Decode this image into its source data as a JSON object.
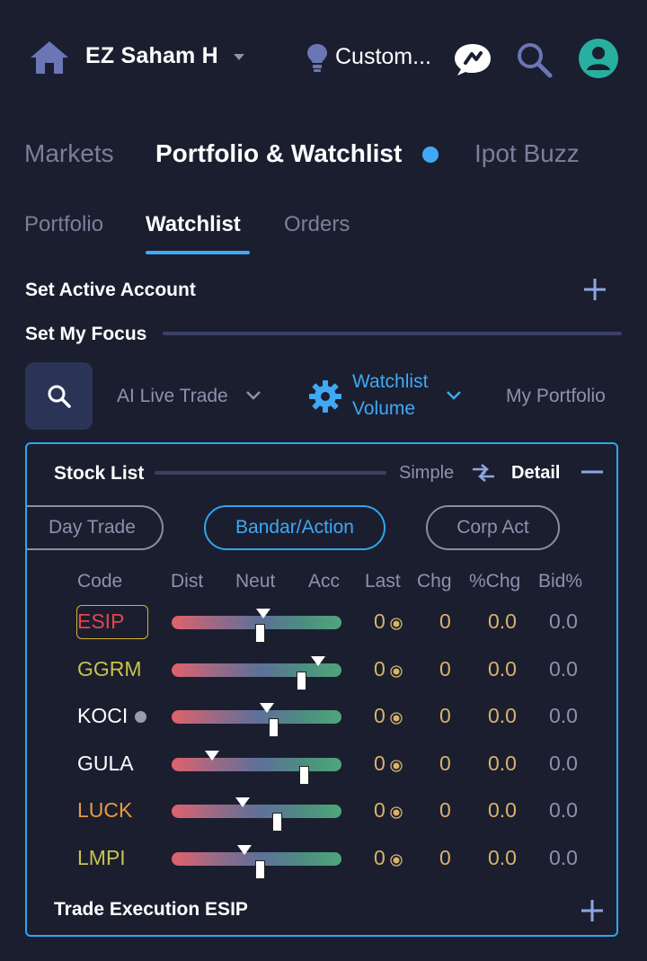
{
  "header": {
    "account_name": "EZ Saham H",
    "custom_label": "Custom...",
    "icons": [
      "home-icon",
      "caret-down-icon",
      "lightbulb-icon",
      "chat-icon",
      "search-icon",
      "user-icon"
    ]
  },
  "main_tabs": [
    {
      "label": "Markets",
      "active": false
    },
    {
      "label": "Portfolio & Watchlist",
      "active": true
    },
    {
      "label": "Ipot Buzz",
      "active": false
    }
  ],
  "sub_tabs": [
    {
      "label": "Portfolio",
      "active": false
    },
    {
      "label": "Watchlist",
      "active": true
    },
    {
      "label": "Orders",
      "active": false
    }
  ],
  "set_active_account": "Set Active Account",
  "set_my_focus": "Set My Focus",
  "focus_row": {
    "ai_live_trade": "AI Live Trade",
    "watchlist_line1": "Watchlist",
    "watchlist_line2": "Volume",
    "my_portfolio": "My Portfolio"
  },
  "stock_list": {
    "title": "Stock List",
    "simple": "Simple",
    "detail": "Detail",
    "filters": [
      "Day Trade",
      "Bandar/Action",
      "Corp Act"
    ],
    "active_filter": "Bandar/Action",
    "columns": [
      "Code",
      "Dist",
      "Neut",
      "Acc",
      "Last",
      "Chg",
      "%Chg",
      "Bid%"
    ],
    "rows": [
      {
        "code": "ESIP",
        "code_color": "#e0474f",
        "selected": true,
        "last": "0",
        "chg": "0",
        "pchg": "0.0",
        "bid": "0.0",
        "triangle": 0.54,
        "knob": 0.52
      },
      {
        "code": "GGRM",
        "code_color": "#c8c24a",
        "selected": false,
        "last": "0",
        "chg": "0",
        "pchg": "0.0",
        "bid": "0.0",
        "triangle": 0.86,
        "knob": 0.76
      },
      {
        "code": "KOCI",
        "code_color": "#ffffff",
        "selected": false,
        "has_dot": true,
        "last": "0",
        "chg": "0",
        "pchg": "0.0",
        "bid": "0.0",
        "triangle": 0.56,
        "knob": 0.6
      },
      {
        "code": "GULA",
        "code_color": "#ffffff",
        "selected": false,
        "last": "0",
        "chg": "0",
        "pchg": "0.0",
        "bid": "0.0",
        "triangle": 0.24,
        "knob": 0.78
      },
      {
        "code": "LUCK",
        "code_color": "#e89a3c",
        "selected": false,
        "last": "0",
        "chg": "0",
        "pchg": "0.0",
        "bid": "0.0",
        "triangle": 0.42,
        "knob": 0.62
      },
      {
        "code": "LMPI",
        "code_color": "#c8c24a",
        "selected": false,
        "last": "0",
        "chg": "0",
        "pchg": "0.0",
        "bid": "0.0",
        "triangle": 0.43,
        "knob": 0.52
      }
    ],
    "trade_execution": "Trade Execution ESIP"
  },
  "colors": {
    "background": "#1b1e2f",
    "accent": "#3fa9f5",
    "value_gold": "#d8b46a",
    "muted": "#8d92ad"
  }
}
